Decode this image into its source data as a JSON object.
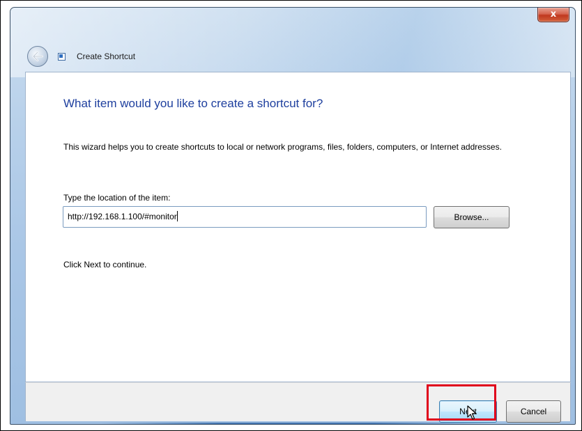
{
  "window": {
    "title": "Create Shortcut",
    "close_glyph": "x"
  },
  "wizard": {
    "heading": "What item would you like to create a shortcut for?",
    "intro": "This wizard helps you to create shortcuts to local or network programs, files, folders, computers, or Internet addresses.",
    "location_label": "Type the location of the item:",
    "location_value": "http://192.168.1.100/#monitor",
    "browse_label": "Browse...",
    "continue_text": "Click Next to continue."
  },
  "footer": {
    "next_label": "Next",
    "cancel_label": "Cancel"
  },
  "icons": {
    "back": "back-arrow-icon",
    "app": "shortcut-icon",
    "close": "close-icon",
    "cursor": "mouse-pointer-icon"
  },
  "colors": {
    "heading": "#1e3f9e",
    "highlight": "#e0001b",
    "close_button": "#c0381f"
  }
}
